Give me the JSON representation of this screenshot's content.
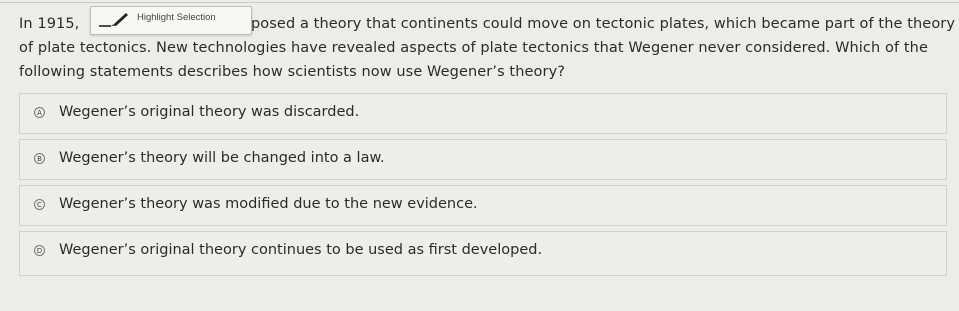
{
  "question": {
    "line1_start": "In 1915,",
    "line1_end": "posed a theory that continents could move on tectonic plates, which became part of the theory",
    "line2": "of plate tectonics. New technologies have revealed aspects of plate tectonics that Wegener never considered. Which of the",
    "line3": "following statements describes how scientists now use Wegener’s theory?"
  },
  "popup": {
    "label": "Highlight Selection",
    "icon": "highlighter-pencil-icon"
  },
  "options": [
    {
      "letter": "A",
      "text": "Wegener’s original theory was discarded."
    },
    {
      "letter": "B",
      "text": "Wegener’s theory will be changed into a law."
    },
    {
      "letter": "C",
      "text": "Wegener’s theory was modified due to the new evidence."
    },
    {
      "letter": "D",
      "text": "Wegener’s original theory continues to be used as first developed."
    }
  ]
}
